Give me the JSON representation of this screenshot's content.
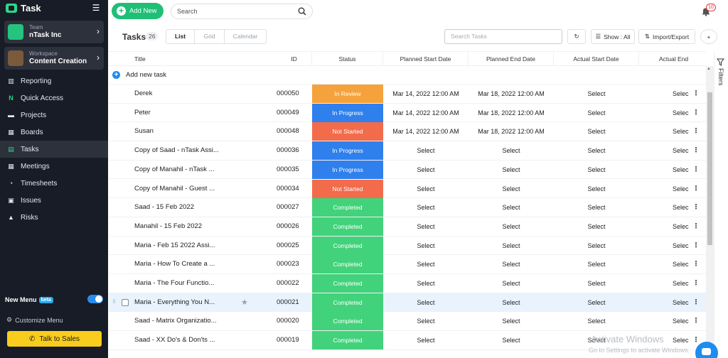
{
  "app": {
    "name": "Task"
  },
  "sidebar": {
    "team": {
      "label": "Team",
      "name": "nTask Inc"
    },
    "workspace": {
      "label": "Workspace",
      "name": "Content Creation"
    },
    "items": [
      {
        "label": "Reporting",
        "icon": "chart-icon"
      },
      {
        "label": "Quick Access",
        "icon": "ntask-logo-icon"
      },
      {
        "label": "Projects",
        "icon": "folder-icon"
      },
      {
        "label": "Boards",
        "icon": "board-icon"
      },
      {
        "label": "Tasks",
        "icon": "tasks-icon",
        "active": true
      },
      {
        "label": "Meetings",
        "icon": "calendar-icon"
      },
      {
        "label": "Timesheets",
        "icon": "timesheet-icon"
      },
      {
        "label": "Issues",
        "icon": "issues-icon"
      },
      {
        "label": "Risks",
        "icon": "warning-icon"
      }
    ],
    "new_menu": "New Menu",
    "beta": "beta",
    "customize": "Customize Menu",
    "talk_to_sales": "Talk to Sales"
  },
  "topbar": {
    "add_new": "Add New",
    "search_placeholder": "Search",
    "notifications": "10"
  },
  "toolbar": {
    "title": "Tasks",
    "count": "26",
    "views": [
      "List",
      "Grid",
      "Calendar"
    ],
    "search_placeholder": "Search Tasks",
    "show": "Show : All",
    "import_export": "Import/Export"
  },
  "table": {
    "columns": [
      "Title",
      "ID",
      "Status",
      "Planned Start Date",
      "Planned End Date",
      "Actual Start Date",
      "Actual End"
    ],
    "add_task": "Add new task",
    "rows": [
      {
        "title": "Derek",
        "id": "000050",
        "status": "In Review",
        "ps": "Mar 14, 2022 12:00 AM",
        "pe": "Mar 18, 2022 12:00 AM",
        "as": "Select",
        "ae": "Selec"
      },
      {
        "title": "Peter",
        "id": "000049",
        "status": "In Progress",
        "ps": "Mar 14, 2022 12:00 AM",
        "pe": "Mar 18, 2022 12:00 AM",
        "as": "Select",
        "ae": "Selec"
      },
      {
        "title": "Susan",
        "id": "000048",
        "status": "Not Started",
        "ps": "Mar 14, 2022 12:00 AM",
        "pe": "Mar 18, 2022 12:00 AM",
        "as": "Select",
        "ae": "Selec"
      },
      {
        "title": "Copy of Saad - nTask Assi...",
        "id": "000036",
        "status": "In Progress",
        "ps": "Select",
        "pe": "Select",
        "as": "Select",
        "ae": "Selec"
      },
      {
        "title": "Copy of Manahil - nTask ...",
        "id": "000035",
        "status": "In Progress",
        "ps": "Select",
        "pe": "Select",
        "as": "Select",
        "ae": "Selec"
      },
      {
        "title": "Copy of Manahil - Guest ...",
        "id": "000034",
        "status": "Not Started",
        "ps": "Select",
        "pe": "Select",
        "as": "Select",
        "ae": "Selec"
      },
      {
        "title": "Saad - 15 Feb 2022",
        "id": "000027",
        "status": "Completed",
        "ps": "Select",
        "pe": "Select",
        "as": "Select",
        "ae": "Selec"
      },
      {
        "title": "Manahil - 15 Feb 2022",
        "id": "000026",
        "status": "Completed",
        "ps": "Select",
        "pe": "Select",
        "as": "Select",
        "ae": "Selec"
      },
      {
        "title": "Maria - Feb 15 2022 Assi...",
        "id": "000025",
        "status": "Completed",
        "ps": "Select",
        "pe": "Select",
        "as": "Select",
        "ae": "Selec"
      },
      {
        "title": "Maria - How To Create a ...",
        "id": "000023",
        "status": "Completed",
        "ps": "Select",
        "pe": "Select",
        "as": "Select",
        "ae": "Selec"
      },
      {
        "title": "Maria - The Four Functio...",
        "id": "000022",
        "status": "Completed",
        "ps": "Select",
        "pe": "Select",
        "as": "Select",
        "ae": "Selec"
      },
      {
        "title": "Maria - Everything You N...",
        "id": "000021",
        "status": "Completed",
        "ps": "Select",
        "pe": "Select",
        "as": "Select",
        "ae": "Selec",
        "highlight": true
      },
      {
        "title": "Saad - Matrix Organizatio...",
        "id": "000020",
        "status": "Completed",
        "ps": "Select",
        "pe": "Select",
        "as": "Select",
        "ae": "Selec"
      },
      {
        "title": "Saad - XX Do's & Don'ts ...",
        "id": "000019",
        "status": "Completed",
        "ps": "Select",
        "pe": "Select",
        "as": "Select",
        "ae": "Selec"
      }
    ]
  },
  "status_colors": {
    "In Review": "#f6a23c",
    "In Progress": "#2f80ed",
    "Not Started": "#f26b4b",
    "Completed": "#42d27b"
  },
  "filters_label": "Filters",
  "watermark": {
    "line1": "Activate Windows",
    "line2": "Go to Settings to activate Windows."
  }
}
